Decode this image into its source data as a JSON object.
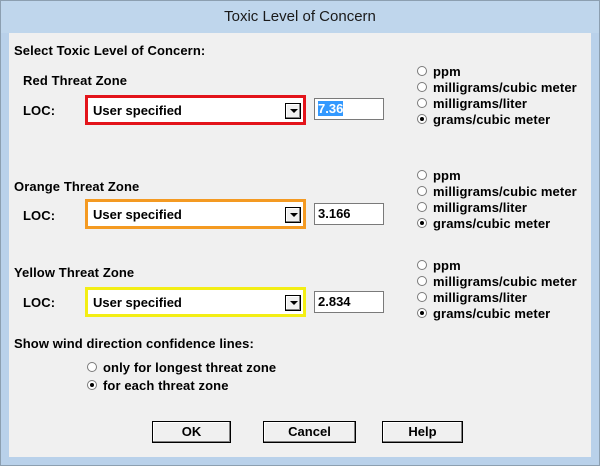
{
  "window": {
    "title": "Toxic Level of Concern"
  },
  "header": "Select Toxic Level of Concern:",
  "loc_label": "LOC:",
  "zones": [
    {
      "name": "Red Threat Zone",
      "loc": "User specified",
      "value": "7.36",
      "border_color": "#e3141b",
      "value_selected": true,
      "units": [
        "ppm",
        "milligrams/cubic meter",
        "milligrams/liter",
        "grams/cubic meter"
      ],
      "unit_selected": 3
    },
    {
      "name": "Orange Threat Zone",
      "loc": "User specified",
      "value": "3.166",
      "border_color": "#f49a22",
      "value_selected": false,
      "units": [
        "ppm",
        "milligrams/cubic meter",
        "milligrams/liter",
        "grams/cubic meter"
      ],
      "unit_selected": 3
    },
    {
      "name": "Yellow Threat Zone",
      "loc": "User specified",
      "value": "2.834",
      "border_color": "#f3ee14",
      "value_selected": false,
      "units": [
        "ppm",
        "milligrams/cubic meter",
        "milligrams/liter",
        "grams/cubic meter"
      ],
      "unit_selected": 3
    }
  ],
  "wind": {
    "label": "Show wind direction confidence lines:",
    "options": [
      "only for longest threat zone",
      "for each threat zone"
    ],
    "selected": 1
  },
  "buttons": {
    "ok": "OK",
    "cancel": "Cancel",
    "help": "Help"
  }
}
